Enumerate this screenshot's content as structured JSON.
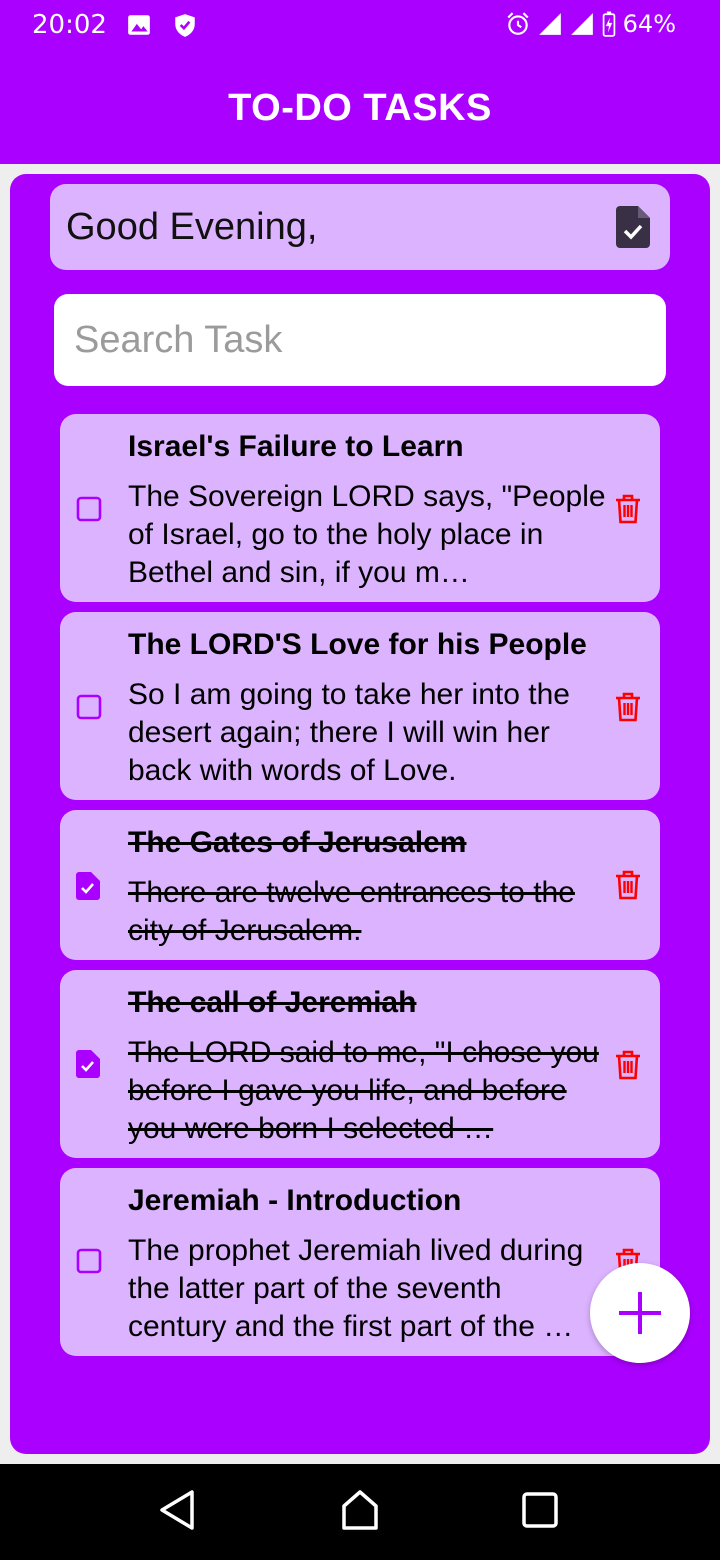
{
  "status_bar": {
    "time": "20:02",
    "battery": "64%",
    "icons": [
      "image-icon",
      "shield-icon",
      "alarm-icon",
      "signal-icon",
      "signal-icon",
      "battery-charging-icon"
    ]
  },
  "app_bar": {
    "title": "TO-DO TASKS"
  },
  "greeting": {
    "text": "Good Evening,",
    "icon": "task-file-icon"
  },
  "search": {
    "placeholder": "Search Task"
  },
  "tasks": [
    {
      "title": "Israel's Failure to Learn",
      "body": "The Sovereign LORD says, \"People of Israel, go to the holy place in Bethel and sin, if you m…",
      "done": false
    },
    {
      "title": "The LORD'S Love for his People",
      "body": "So I am going to take her into the desert again; there I will win her back with words of Love.",
      "done": false
    },
    {
      "title": "The Gates of Jerusalem ",
      "body": "There are twelve entrances to the city of Jerusalem.",
      "done": true
    },
    {
      "title": "The call of Jeremiah ",
      "body": "The LORD said to me, \"I chose you before I gave you life, and before you were born I selected …",
      "done": true
    },
    {
      "title": "Jeremiah - Introduction",
      "body": "The prophet Jeremiah lived during the latter part of the seventh century and the first part of the …",
      "done": false
    }
  ],
  "fab": {
    "icon": "plus-icon"
  },
  "nav": {
    "buttons": [
      "back-icon",
      "home-icon",
      "recents-icon"
    ]
  },
  "colors": {
    "accent": "#aa00ff",
    "card": "#dcb3ff",
    "delete": "#ff0000",
    "check": "#aa00ff"
  }
}
